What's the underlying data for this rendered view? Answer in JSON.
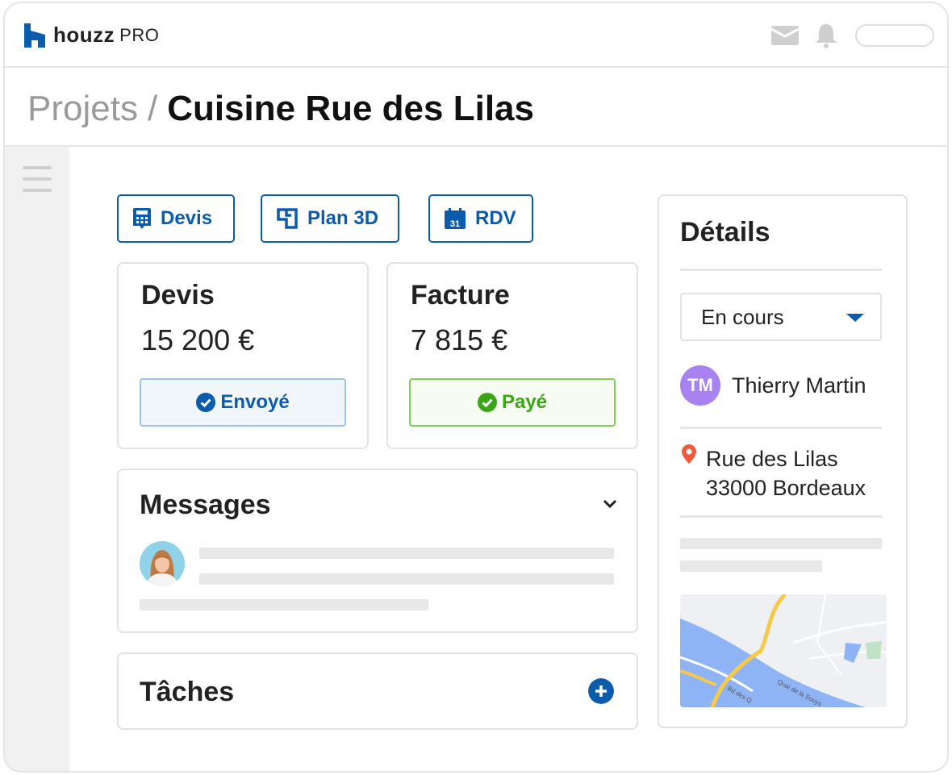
{
  "header": {
    "brand": "houzz",
    "brand_suffix": "PRO",
    "icons": [
      "mail-icon",
      "bell-icon"
    ]
  },
  "breadcrumb": {
    "parent": "Projets",
    "separator": "/",
    "current": "Cuisine Rue des Lilas"
  },
  "actions": [
    {
      "label": "Devis",
      "icon": "calculator-icon"
    },
    {
      "label": "Plan 3D",
      "icon": "floorplan-icon"
    },
    {
      "label": "RDV",
      "icon": "calendar-icon",
      "icon_text": "31"
    }
  ],
  "devis": {
    "title": "Devis",
    "amount": "15 200 €",
    "status": "Envoyé"
  },
  "facture": {
    "title": "Facture",
    "amount": "7 815 €",
    "status": "Payé"
  },
  "messages": {
    "title": "Messages"
  },
  "taches": {
    "title": "Tâches"
  },
  "details": {
    "title": "Détails",
    "status_selected": "En cours",
    "client_initials": "TM",
    "client_name": "Thierry Martin",
    "address_line1": "Rue des Lilas",
    "address_line2": "33000 Bordeaux"
  },
  "map": {
    "labels": [
      "Quai de la Souys",
      "Bd des Q"
    ]
  },
  "colors": {
    "brand_blue": "#0b5cad",
    "paid_green": "#3aa617",
    "avatar_purple": "#a882f0",
    "pin_red": "#f05a3c"
  }
}
